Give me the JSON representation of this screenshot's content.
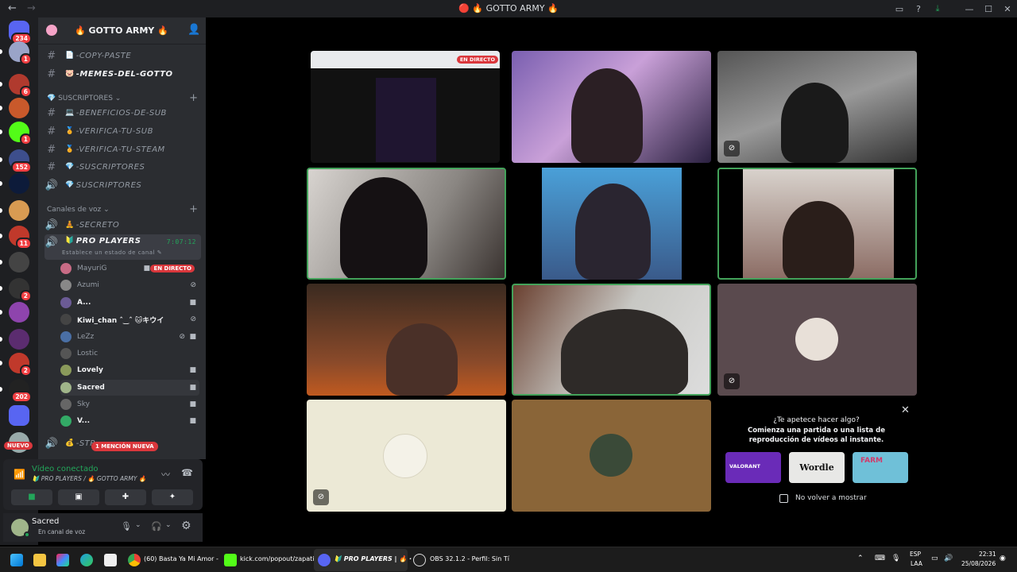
{
  "window": {
    "title": "🔴 🔥 GOTTO ARMY 🔥"
  },
  "servers": [
    {
      "name": "direct-messages",
      "badge": "234",
      "color": "#5865f2"
    },
    {
      "name": "server-2",
      "badge": "1",
      "color": "#9aa4c8"
    },
    {
      "name": "server-3",
      "badge": "6",
      "color": "#b03a2e"
    },
    {
      "name": "server-4",
      "badge": "",
      "color": "#c9592b"
    },
    {
      "name": "server-kick",
      "badge": "1",
      "color": "#53fc18"
    },
    {
      "name": "server-6",
      "badge": "152",
      "color": "#3d4e8c"
    },
    {
      "name": "server-kt",
      "badge": "",
      "color": "#0d1b3a"
    },
    {
      "name": "server-8",
      "badge": "",
      "color": "#d89b52"
    },
    {
      "name": "server-9",
      "badge": "11",
      "color": "#c0392b"
    },
    {
      "name": "server-10",
      "badge": "",
      "color": "#444"
    },
    {
      "name": "server-11",
      "badge": "2",
      "color": "#333"
    },
    {
      "name": "server-12",
      "badge": "",
      "color": "#8e44ad"
    },
    {
      "name": "server-13",
      "badge": "",
      "color": "#5b2c6f"
    },
    {
      "name": "server-14",
      "badge": "2",
      "color": "#c0392b"
    },
    {
      "name": "server-15",
      "badge": "202",
      "color": "#222"
    },
    {
      "name": "server-folder",
      "badge": "",
      "color": "#5865f2"
    },
    {
      "name": "server-new",
      "badge": "",
      "color": "#9aa"
    }
  ],
  "guild": {
    "name": "🔥 GOTTO ARMY 🔥"
  },
  "channels_top": [
    {
      "icon": "#",
      "emoji": "📄",
      "name": "-COPY-PASTE"
    },
    {
      "icon": "#",
      "emoji": "🐷",
      "name": "-MEMES-DEL-GOTTO"
    }
  ],
  "category_subs": {
    "label": "💎 SUSCRIPTORES"
  },
  "channels_subs": [
    {
      "icon": "#",
      "emoji": "💻",
      "name": "-BENEFICIOS-DE-SUB"
    },
    {
      "icon": "#",
      "emoji": "🏅",
      "name": "-VERIFICA-TU-SUB"
    },
    {
      "icon": "#",
      "emoji": "🏅",
      "name": "-VERIFICA-TU-STEAM"
    },
    {
      "icon": "#",
      "emoji": "💎",
      "name": "-SUSCRIPTORES"
    },
    {
      "icon": "🔊",
      "emoji": "💎",
      "name": "SUSCRIPTORES"
    }
  ],
  "category_voice": {
    "label": "Canales de voz"
  },
  "voice_channels": {
    "secret": {
      "emoji": "🧘",
      "name": "-SECRETO"
    },
    "active": {
      "emoji": "🔰",
      "name": "PRO PLAYERS",
      "timer": "7:07:12",
      "status": "Establece un estado de canal"
    },
    "next": {
      "emoji": "💰",
      "name": "-STR"
    }
  },
  "members": [
    {
      "name": "MayuriG",
      "color": "#c86b85",
      "live": true
    },
    {
      "name": "Azumi",
      "color": "#888"
    },
    {
      "name": "A...",
      "color": "#6b5b95"
    },
    {
      "name": "Kiwi_chan ˆ‿ˆ 🐱キウイ",
      "color": "#444"
    },
    {
      "name": "LeZz",
      "color": "#4a6fa5"
    },
    {
      "name": "Lostic",
      "color": "#555"
    },
    {
      "name": "Lovely",
      "color": "#8a9a5b"
    },
    {
      "name": "Sacred",
      "color": "#a0b58a"
    },
    {
      "name": "Sky",
      "color": "#666"
    },
    {
      "name": "V...",
      "color": "#3a6"
    }
  ],
  "live_label": "EN DIRECTO",
  "new_mention": "1 MENCIÓN NUEVA",
  "new_label": "NUEVO",
  "voice_panel": {
    "status": "Vídeo conectado",
    "location": "🔰 PRO PLAYERS / 🔥 GOTTO ARMY 🔥"
  },
  "user_panel": {
    "name": "Sacred",
    "status": "En canal de voz"
  },
  "activity": {
    "question": "¿Te apetece hacer algo?",
    "body": "Comienza una partida o una lista de reproducción de vídeos al instante.",
    "games": [
      {
        "name": "VALORANT",
        "bg": "#6a2bb8"
      },
      {
        "name": "Wordle",
        "bg": "#e8e8e6"
      },
      {
        "name": "FARM",
        "bg": "#6fc0d8"
      }
    ],
    "dont_show": "No volver a mostrar"
  },
  "taskbar": {
    "chrome_label": "(60) Basta Ya Mi Amor -",
    "kick_label": "kick.com/popout/zapati",
    "discord_label": "🔰 PRO PLAYERS | 🔥 ·",
    "obs_label": "OBS 32.1.2 - Perfil: Sin Tí",
    "lang_1": "ESP",
    "lang_2": "LAA",
    "time": "22:31",
    "date": "25/08/2026"
  },
  "colors": {
    "accent": "#5865f2",
    "speaking": "#43a25a",
    "danger": "#da373c",
    "connected": "#23a55a"
  }
}
